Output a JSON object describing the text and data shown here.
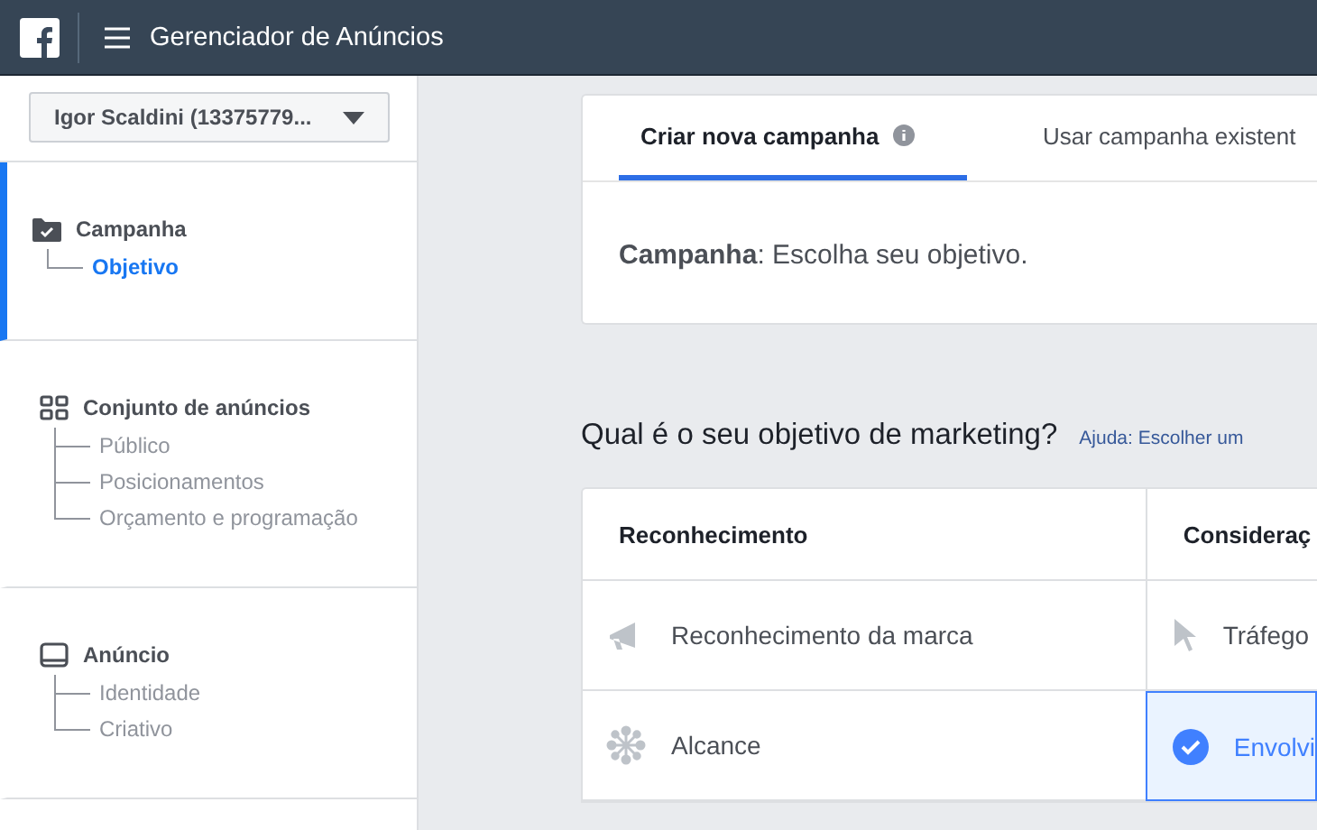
{
  "topbar": {
    "title": "Gerenciador de Anúncios"
  },
  "sidebar": {
    "account": "Igor Scaldini (13375779...",
    "sections": [
      {
        "title": "Campanha",
        "active": true,
        "children": [
          {
            "label": "Objetivo",
            "selected": true
          }
        ]
      },
      {
        "title": "Conjunto de anúncios",
        "active": false,
        "children": [
          {
            "label": "Público",
            "selected": false
          },
          {
            "label": "Posicionamentos",
            "selected": false
          },
          {
            "label": "Orçamento e programação",
            "selected": false
          }
        ]
      },
      {
        "title": "Anúncio",
        "active": false,
        "children": [
          {
            "label": "Identidade",
            "selected": false
          },
          {
            "label": "Criativo",
            "selected": false
          }
        ]
      }
    ]
  },
  "tabs": [
    {
      "label": "Criar nova campanha",
      "selected": true
    },
    {
      "label": "Usar campanha existent",
      "selected": false
    }
  ],
  "campaign_line": "**Campanha**: Escolha seu objetivo.",
  "question": {
    "title": "Qual é o seu objetivo de marketing?",
    "help_link": "Ajuda: Escolher um"
  },
  "objectives": [
    {
      "title": "Reconhecimento",
      "items": [
        {
          "label": "Reconhecimento da marca",
          "selected": false
        },
        {
          "label": "Alcance",
          "selected": false
        }
      ]
    },
    {
      "title": "Consideraç",
      "items": [
        {
          "label": "Tráfego",
          "selected": false
        },
        {
          "label": "Envolvi",
          "selected": true
        }
      ]
    }
  ]
}
